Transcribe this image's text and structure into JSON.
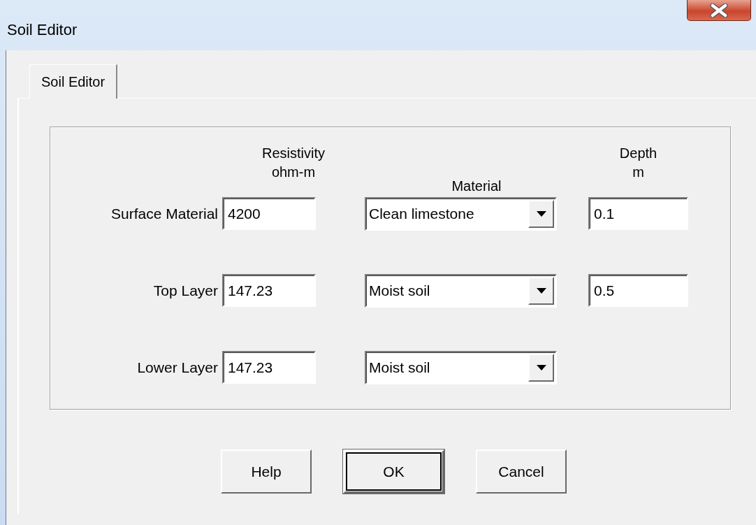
{
  "window": {
    "title": "Soil Editor"
  },
  "tabs": [
    {
      "label": "Soil Editor",
      "selected": true
    }
  ],
  "columns": [
    {
      "lines": [
        "Resistivity",
        "ohm-m"
      ]
    },
    {
      "lines": [
        "Material"
      ]
    },
    {
      "lines": [
        "Depth",
        "m"
      ]
    }
  ],
  "rows": [
    {
      "label": "Surface Material",
      "resistivity": "4200",
      "material": "Clean limestone",
      "depth": "0.1"
    },
    {
      "label": "Top Layer",
      "resistivity": "147.23",
      "material": "Moist soil",
      "depth": "0.5"
    },
    {
      "label": "Lower Layer",
      "resistivity": "147.23",
      "material": "Moist soil"
    }
  ],
  "buttons": [
    {
      "label": "Help",
      "default": false
    },
    {
      "label": "OK",
      "default": true
    },
    {
      "label": "Cancel",
      "default": false
    }
  ]
}
